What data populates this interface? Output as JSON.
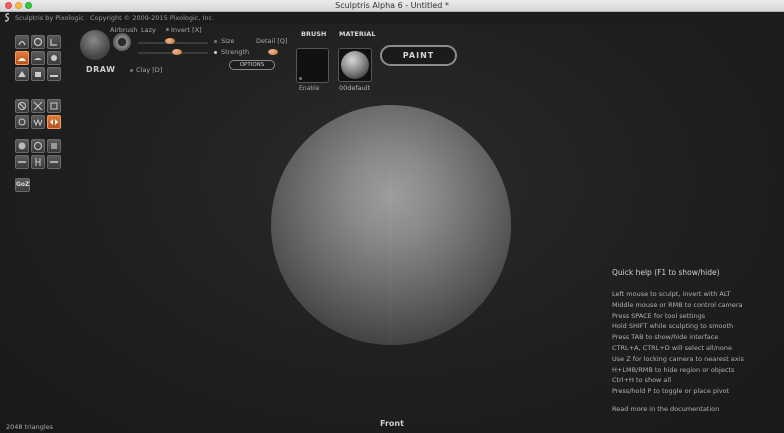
{
  "window": {
    "title": "Sculptris Alpha 6 - Untitled *"
  },
  "app": {
    "name": "Sculptris by Pixologic",
    "copyright": "Copyright © 2009-2015 Pixologic, Inc."
  },
  "toolbar": {
    "left_tools": [
      "crease-icon",
      "rotate-icon",
      "scale-icon",
      "draw-icon",
      "flatten-icon",
      "inflate-icon",
      "pinch-icon",
      "grab-icon",
      "smooth-icon",
      "reduce-icon",
      "mask-icon",
      "symmetry-icon",
      "wireframe-icon",
      "subdivide-icon",
      "reduce-brush-icon",
      "sphere-icon",
      "plane-icon",
      "import-icon"
    ],
    "active_tool": "draw",
    "goz_label": "GoZ",
    "accent": "#d86a2e"
  },
  "brush_panel": {
    "draw_label": "DRAW",
    "airbrush_label": "Airbrush",
    "lazy_label": "Lazy",
    "invert_label": "Invert [X]",
    "size_label": "Size",
    "detail_label": "Detail [Q]",
    "strength_label": "Strength",
    "clay_label": "Clay [D]",
    "options_label": "OPTIONS"
  },
  "brush": {
    "title": "BRUSH",
    "enable_label": "Enable"
  },
  "material": {
    "title": "MATERIAL",
    "name": "00default"
  },
  "mode": {
    "paint_label": "PAINT"
  },
  "help": {
    "title": "Quick help (F1 to show/hide)",
    "lines": [
      "Left mouse to sculpt, invert with ALT",
      "Middle mouse or RMB to control camera",
      "Press SPACE for tool settings",
      "Hold SHIFT while sculpting to smooth",
      "Press TAB to show/hide interface",
      "CTRL+A, CTRL+D will select all/none",
      "Use Z for locking camera to nearest axis",
      "H+LMB/RMB to hide region or objects",
      "Ctrl+H to show all",
      "Press/hold P to toggle or place pivot"
    ],
    "more": "Read more in the documentation"
  },
  "status": {
    "triangles": "2048 triangles",
    "view": "Front"
  }
}
